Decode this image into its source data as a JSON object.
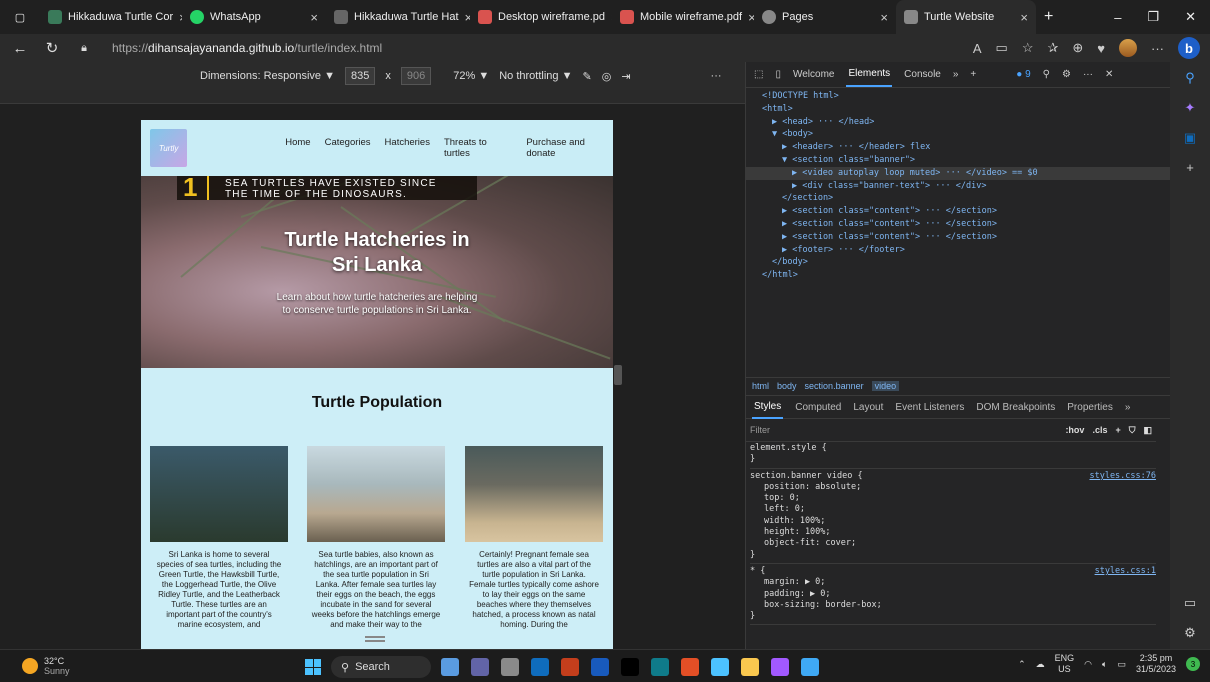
{
  "browser": {
    "tabs": [
      {
        "label": "Hikkaduwa Turtle Cor",
        "color": "#3a7a5a",
        "active": false
      },
      {
        "label": "WhatsApp",
        "color": "#25d366",
        "active": false
      },
      {
        "label": "Hikkaduwa Turtle Hat",
        "color": "#666666",
        "active": false
      },
      {
        "label": "Desktop wireframe.pd",
        "color": "#d9534f",
        "active": false
      },
      {
        "label": "Mobile wireframe.pdf",
        "color": "#d9534f",
        "active": false
      },
      {
        "label": "Pages",
        "color": "#888888",
        "active": false
      },
      {
        "label": "Turtle Website",
        "color": "#888888",
        "active": true
      }
    ],
    "url_prefix": "https://",
    "url_host": "dihansajayananda.github.io",
    "url_path": "/turtle/index.html"
  },
  "device_toolbar": {
    "dimensions_label": "Dimensions: Responsive",
    "width": "835",
    "x": "x",
    "height": "906",
    "zoom": "72%",
    "throttle": "No throttling"
  },
  "site": {
    "logo_text": "Turtly",
    "nav": [
      "Home",
      "Categories",
      "Hatcheries",
      "Threats to turtles",
      "Purchase and donate"
    ],
    "fact_number": "1",
    "fact_line1": "SEA TURTLES HAVE EXISTED SINCE",
    "fact_line2": "THE TIME OF THE DINOSAURS.",
    "banner_title_1": "Turtle Hatcheries in",
    "banner_title_2": "Sri Lanka",
    "banner_sub_1": "Learn about how turtle hatcheries are helping",
    "banner_sub_2": "to conserve turtle populations in Sri Lanka.",
    "section_title": "Turtle Population",
    "cards": [
      {
        "text": "Sri Lanka is home to several species of sea turtles, including the Green Turtle, the Hawksbill Turtle, the Loggerhead Turtle, the Olive Ridley Turtle, and the Leatherback Turtle. These turtles are an important part of the country's marine ecosystem, and",
        "img_top": "#3b5a6a",
        "img_bottom": "#2a3a2e"
      },
      {
        "text": "Sea turtle babies, also known as hatchlings, are an important part of the sea turtle population in Sri Lanka. After female sea turtles lay their eggs on the beach, the eggs incubate in the sand for several weeks before the hatchlings emerge and make their way to the",
        "img_top": "#c9d9e0",
        "img_bottom": "#b8a890"
      },
      {
        "text": "Certainly! Pregnant female sea turtles are also a vital part of the turtle population in Sri Lanka. Female turtles typically come ashore to lay their eggs on the same beaches where they themselves hatched, a process known as natal homing. During the",
        "img_top": "#4a5a5a",
        "img_bottom": "#c8b490"
      }
    ]
  },
  "devtools": {
    "tabs": [
      "Welcome",
      "Elements",
      "Console",
      "»",
      "+"
    ],
    "issues": "9",
    "dom_lines": [
      {
        "indent": 0,
        "text": "<!DOCTYPE html>"
      },
      {
        "indent": 0,
        "text": "<html>"
      },
      {
        "indent": 1,
        "text": "▶ <head> ··· </head>"
      },
      {
        "indent": 1,
        "text": "▼ <body>"
      },
      {
        "indent": 2,
        "text": "▶ <header> ··· </header> flex"
      },
      {
        "indent": 2,
        "text": "▼ <section class=\"banner\">"
      },
      {
        "indent": 3,
        "text": "▶ <video autoplay loop muted> ··· </video> == $0"
      },
      {
        "indent": 3,
        "text": "▶ <div class=\"banner-text\"> ··· </div>"
      },
      {
        "indent": 2,
        "text": "</section>"
      },
      {
        "indent": 2,
        "text": "▶ <section class=\"content\"> ··· </section>"
      },
      {
        "indent": 2,
        "text": "▶ <section class=\"content\"> ··· </section>"
      },
      {
        "indent": 2,
        "text": "▶ <section class=\"content\"> ··· </section>"
      },
      {
        "indent": 2,
        "text": "▶ <footer> ··· </footer>"
      },
      {
        "indent": 1,
        "text": "</body>"
      },
      {
        "indent": 0,
        "text": "</html>"
      }
    ],
    "breadcrumbs": [
      "html",
      "body",
      "section.banner",
      "video"
    ],
    "style_tabs": [
      "Styles",
      "Computed",
      "Layout",
      "Event Listeners",
      "DOM Breakpoints",
      "Properties",
      "»"
    ],
    "filter_placeholder": "Filter",
    "filter_hov": ":hov",
    "filter_cls": ".cls",
    "rules": [
      {
        "selector": "element.style {",
        "source": "",
        "props": []
      },
      {
        "selector": "section.banner video {",
        "source": "styles.css:76",
        "props": [
          "position: absolute;",
          "top: 0;",
          "left: 0;",
          "width: 100%;",
          "height: 100%;",
          "object-fit: cover;"
        ]
      },
      {
        "selector": "* {",
        "source": "styles.css:1",
        "props": [
          "margin: ▶ 0;",
          "padding: ▶ 0;",
          "box-sizing: border-box;"
        ]
      }
    ]
  },
  "taskbar": {
    "temp": "32°C",
    "weather": "Sunny",
    "search": "Search",
    "lang": "ENG",
    "region": "US",
    "time": "2:35 pm",
    "date": "31/5/2023",
    "apps": [
      "#5a9be0",
      "#6264a7",
      "#8a8a8a",
      "#0f6cbd",
      "#c43e1c",
      "#185abd",
      "#000000",
      "#0f7b8a",
      "#e34f26",
      "#4cc2ff",
      "#f9c74f",
      "#a259ff",
      "#3fa9f5"
    ]
  }
}
